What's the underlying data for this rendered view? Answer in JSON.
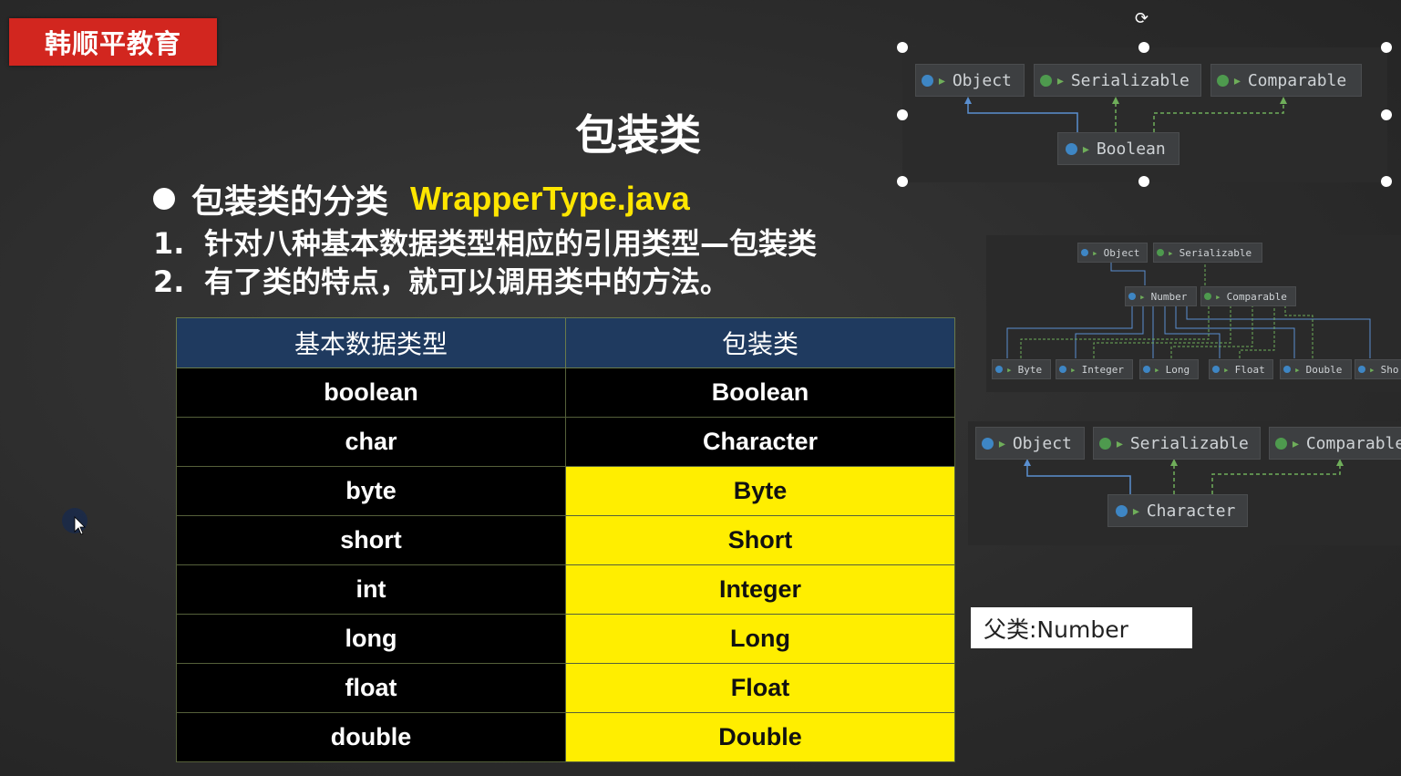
{
  "brand": {
    "logo_text": "韩顺平教育"
  },
  "slide": {
    "title": "包装类",
    "bullet": {
      "label": "包装类的分类",
      "file": "WrapperType.java"
    },
    "points": [
      {
        "num": "1.",
        "text": "针对八种基本数据类型相应的引用类型—包装类"
      },
      {
        "num": "2.",
        "text": "有了类的特点，就可以调用类中的方法。"
      }
    ]
  },
  "table": {
    "headers": [
      "基本数据类型",
      "包装类"
    ],
    "rows": [
      {
        "primitive": "boolean",
        "wrapper": "Boolean",
        "highlight": false
      },
      {
        "primitive": "char",
        "wrapper": "Character",
        "highlight": false
      },
      {
        "primitive": "byte",
        "wrapper": "Byte",
        "highlight": true
      },
      {
        "primitive": "short",
        "wrapper": "Short",
        "highlight": true
      },
      {
        "primitive": "int",
        "wrapper": "Integer",
        "highlight": true
      },
      {
        "primitive": "long",
        "wrapper": "Long",
        "highlight": true
      },
      {
        "primitive": "float",
        "wrapper": "Float",
        "highlight": true
      },
      {
        "primitive": "double",
        "wrapper": "Double",
        "highlight": true
      }
    ],
    "highlight_color": "#ffee00"
  },
  "diagrams": {
    "boolean": {
      "object": "Object",
      "serializable": "Serializable",
      "comparable": "Comparable",
      "child": "Boolean"
    },
    "number": {
      "object": "Object",
      "serializable": "Serializable",
      "number": "Number",
      "comparable": "Comparable",
      "children": [
        "Byte",
        "Integer",
        "Long",
        "Float",
        "Double",
        "Sho"
      ]
    },
    "character": {
      "object": "Object",
      "serializable": "Serializable",
      "comparable": "Comparable",
      "child": "Character"
    }
  },
  "note": {
    "text": "父类:Number"
  },
  "icons": {
    "rotate": "rotate-handle-icon",
    "cursor": "mouse-pointer-icon"
  }
}
